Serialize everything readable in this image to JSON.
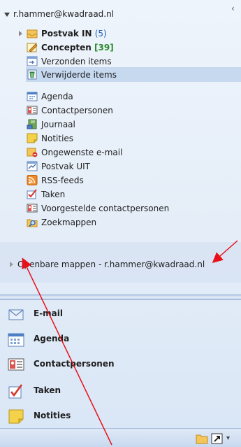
{
  "account": {
    "email": "r.hammer@kwadraad.nl"
  },
  "folders": [
    {
      "label": "Postvak IN",
      "count": "(5)",
      "icon": "inbox-icon"
    },
    {
      "label": "Concepten",
      "count": "[39]",
      "icon": "drafts-icon"
    },
    {
      "label": "Verzonden items",
      "count": "",
      "icon": "sent-items-icon"
    },
    {
      "label": "Verwijderde items",
      "count": "",
      "icon": "deleted-items-icon"
    },
    {
      "label": "Agenda",
      "count": "",
      "icon": "calendar-icon"
    },
    {
      "label": "Contactpersonen",
      "count": "",
      "icon": "contacts-icon"
    },
    {
      "label": "Journaal",
      "count": "",
      "icon": "journal-icon"
    },
    {
      "label": "Notities",
      "count": "",
      "icon": "notes-icon"
    },
    {
      "label": "Ongewenste e-mail",
      "count": "",
      "icon": "junk-mail-icon"
    },
    {
      "label": "Postvak UIT",
      "count": "",
      "icon": "outbox-icon"
    },
    {
      "label": "RSS-feeds",
      "count": "",
      "icon": "rss-icon"
    },
    {
      "label": "Taken",
      "count": "",
      "icon": "tasks-icon"
    },
    {
      "label": "Voorgestelde contactpersonen",
      "count": "",
      "icon": "suggested-contacts-icon"
    },
    {
      "label": "Zoekmappen",
      "count": "",
      "icon": "search-folders-icon"
    }
  ],
  "selected_folder": "Verwijderde items",
  "public_folders": {
    "label": "Openbare mappen - r.hammer@kwadraad.nl"
  },
  "nav_buttons": [
    {
      "label": "E-mail",
      "icon": "mail-icon"
    },
    {
      "label": "Agenda",
      "icon": "calendar-icon"
    },
    {
      "label": "Contactpersonen",
      "icon": "contacts-icon"
    },
    {
      "label": "Taken",
      "icon": "tasks-icon"
    },
    {
      "label": "Notities",
      "icon": "notes-icon"
    }
  ],
  "colors": {
    "selection": "#c6d9ef",
    "annotation_arrow": "#e8111a",
    "count_blue": "#1a5dbb",
    "count_green": "#2a8a2a"
  }
}
